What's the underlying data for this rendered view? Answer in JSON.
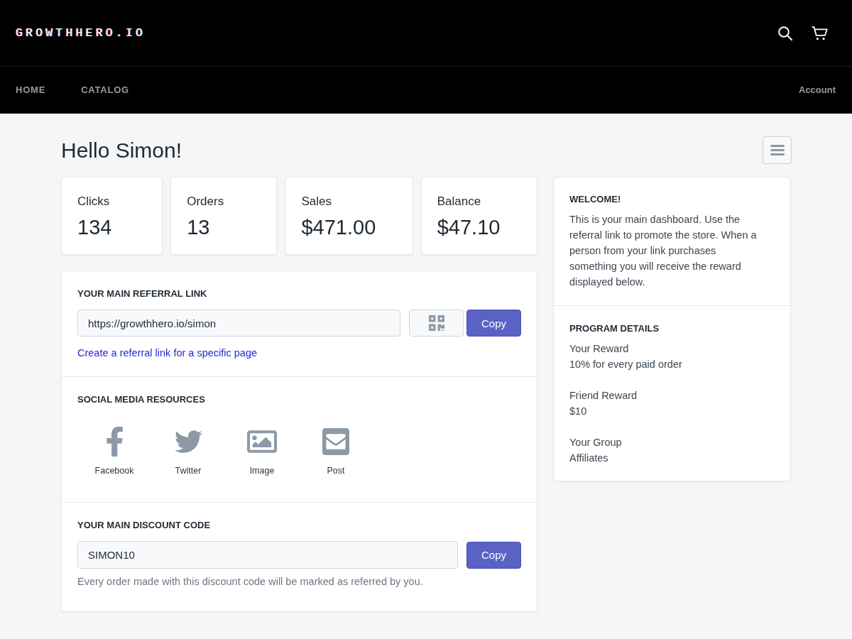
{
  "header": {
    "logo": "GROWTHHERO.IO"
  },
  "nav": {
    "items": [
      {
        "label": "HOME"
      },
      {
        "label": "CATALOG"
      }
    ],
    "account": "Account"
  },
  "greeting": "Hello Simon!",
  "stats": [
    {
      "label": "Clicks",
      "value": "134"
    },
    {
      "label": "Orders",
      "value": "13"
    },
    {
      "label": "Sales",
      "value": "$471.00"
    },
    {
      "label": "Balance",
      "value": "$47.10"
    }
  ],
  "referral": {
    "heading": "YOUR MAIN REFERRAL LINK",
    "link": "https://growthhero.io/simon",
    "copy_button": "Copy",
    "create_link": "Create a referral link for a specific page"
  },
  "social": {
    "heading": "SOCIAL MEDIA RESOURCES",
    "items": [
      {
        "kind": "facebook",
        "label": "Facebook"
      },
      {
        "kind": "twitter",
        "label": "Twitter"
      },
      {
        "kind": "image",
        "label": "Image"
      },
      {
        "kind": "post",
        "label": "Post"
      }
    ]
  },
  "discount": {
    "heading": "YOUR MAIN DISCOUNT CODE",
    "code": "SIMON10",
    "copy_button": "Copy",
    "note": "Every order made with this discount code will be marked as referred by you."
  },
  "welcome": {
    "heading": "WELCOME!",
    "text": "This is your main dashboard. Use the referral link to promote the store. When a person from your link purchases something you will receive the reward displayed below."
  },
  "program": {
    "heading": "PROGRAM DETAILS",
    "details": [
      {
        "label": "Your Reward",
        "value": "10% for every paid order"
      },
      {
        "label": "Friend Reward",
        "value": "$10"
      },
      {
        "label": "Your Group",
        "value": "Affiliates"
      }
    ]
  }
}
